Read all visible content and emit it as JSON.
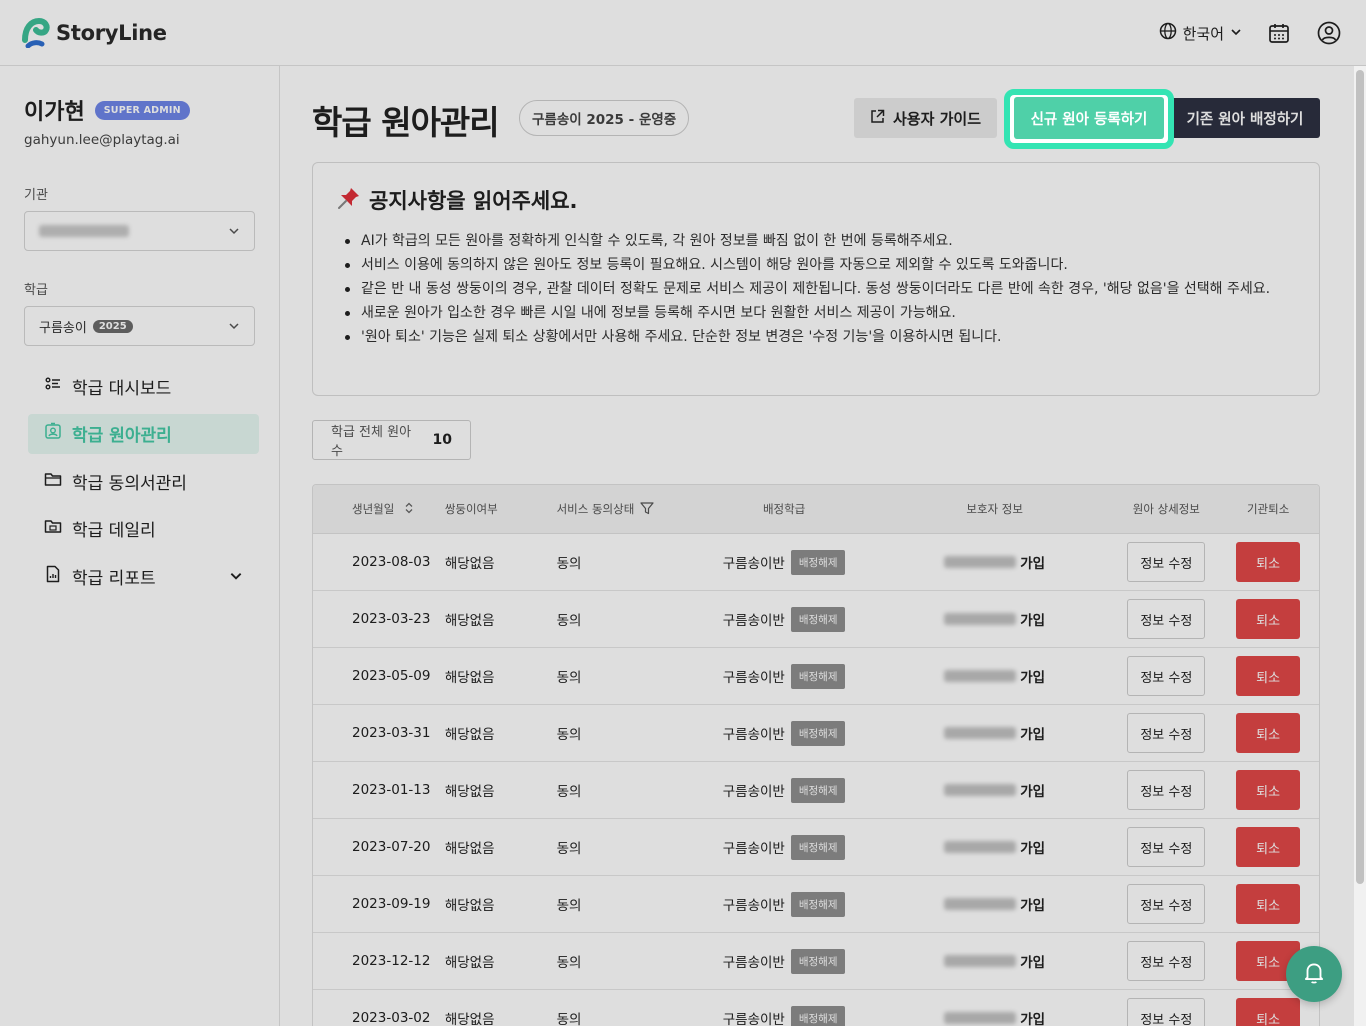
{
  "app": {
    "name": "StoryLine"
  },
  "header": {
    "language": "한국어"
  },
  "user": {
    "name": "이가현",
    "role_badge": "SUPER ADMIN",
    "email": "gahyun.lee@playtag.ai"
  },
  "sidebar": {
    "org_label": "기관",
    "class_label": "학급",
    "class_select": {
      "value": "구름송이",
      "year": "2025"
    },
    "items": [
      {
        "label": "학급 대시보드",
        "icon": "dashboard-list-icon"
      },
      {
        "label": "학급 원아관리",
        "icon": "child-profile-icon",
        "active": true
      },
      {
        "label": "학급 동의서관리",
        "icon": "folder-icon"
      },
      {
        "label": "학급 데일리",
        "icon": "daily-folder-icon"
      },
      {
        "label": "학급 리포트",
        "icon": "report-icon",
        "expandable": true
      }
    ]
  },
  "main": {
    "title": "학급 원아관리",
    "season_chip": "구름송이 2025 - 운영중",
    "buttons": {
      "guide": "사용자 가이드",
      "new_child": "신규 원아 등록하기",
      "assign_existing": "기존 원아 배정하기"
    },
    "notice": {
      "title": "공지사항을 읽어주세요.",
      "items": [
        "AI가 학급의 모든 원아를 정확하게 인식할 수 있도록, 각 원아 정보를 빠짐 없이 한 번에 등록해주세요.",
        "서비스 이용에 동의하지 않은 원아도 정보 등록이 필요해요. 시스템이 해당 원아를 자동으로 제외할 수 있도록 도와줍니다.",
        "같은 반 내 동성 쌍둥이의 경우, 관찰 데이터 정확도 문제로 서비스 제공이 제한됩니다. 동성 쌍둥이더라도 다른 반에 속한 경우, '해당 없음'을 선택해 주세요.",
        "새로운 원아가 입소한 경우 빠른 시일 내에 정보를 등록해 주시면 보다 원활한 서비스 제공이 가능해요.",
        "'원아 퇴소' 기능은 실제 퇴소 상황에서만 사용해 주세요. 단순한 정보 변경은 '수정 기능'을 이용하시면 됩니다."
      ]
    },
    "count": {
      "label": "학급 전체 원아 수",
      "value": "10"
    },
    "table": {
      "headers": {
        "birth": "생년월일",
        "twin": "쌍둥이여부",
        "consent": "서비스 동의상태",
        "class": "배정학급",
        "guardian": "보호자 정보",
        "detail": "원아 상세정보",
        "leave": "기관퇴소"
      },
      "rows": [
        {
          "birth": "2023-08-03",
          "twin": "해당없음",
          "consent": "동의",
          "class": "구름송이반",
          "unassign": "배정해제",
          "status": "가입",
          "edit": "정보 수정",
          "leave": "퇴소"
        },
        {
          "birth": "2023-03-23",
          "twin": "해당없음",
          "consent": "동의",
          "class": "구름송이반",
          "unassign": "배정해제",
          "status": "가입",
          "edit": "정보 수정",
          "leave": "퇴소"
        },
        {
          "birth": "2023-05-09",
          "twin": "해당없음",
          "consent": "동의",
          "class": "구름송이반",
          "unassign": "배정해제",
          "status": "가입",
          "edit": "정보 수정",
          "leave": "퇴소"
        },
        {
          "birth": "2023-03-31",
          "twin": "해당없음",
          "consent": "동의",
          "class": "구름송이반",
          "unassign": "배정해제",
          "status": "가입",
          "edit": "정보 수정",
          "leave": "퇴소"
        },
        {
          "birth": "2023-01-13",
          "twin": "해당없음",
          "consent": "동의",
          "class": "구름송이반",
          "unassign": "배정해제",
          "status": "가입",
          "edit": "정보 수정",
          "leave": "퇴소"
        },
        {
          "birth": "2023-07-20",
          "twin": "해당없음",
          "consent": "동의",
          "class": "구름송이반",
          "unassign": "배정해제",
          "status": "가입",
          "edit": "정보 수정",
          "leave": "퇴소"
        },
        {
          "birth": "2023-09-19",
          "twin": "해당없음",
          "consent": "동의",
          "class": "구름송이반",
          "unassign": "배정해제",
          "status": "가입",
          "edit": "정보 수정",
          "leave": "퇴소"
        },
        {
          "birth": "2023-12-12",
          "twin": "해당없음",
          "consent": "동의",
          "class": "구름송이반",
          "unassign": "배정해제",
          "status": "가입",
          "edit": "정보 수정",
          "leave": "퇴소"
        },
        {
          "birth": "2023-03-02",
          "twin": "해당없음",
          "consent": "동의",
          "class": "구름송이반",
          "unassign": "배정해제",
          "status": "가입",
          "edit": "정보 수정",
          "leave": "퇴소"
        }
      ]
    }
  },
  "colors": {
    "accent": "#4fd0a8",
    "highlight": "#34e4b3",
    "danger": "#e24848",
    "dark_button": "#2d3142",
    "badge": "#6f86e8"
  }
}
